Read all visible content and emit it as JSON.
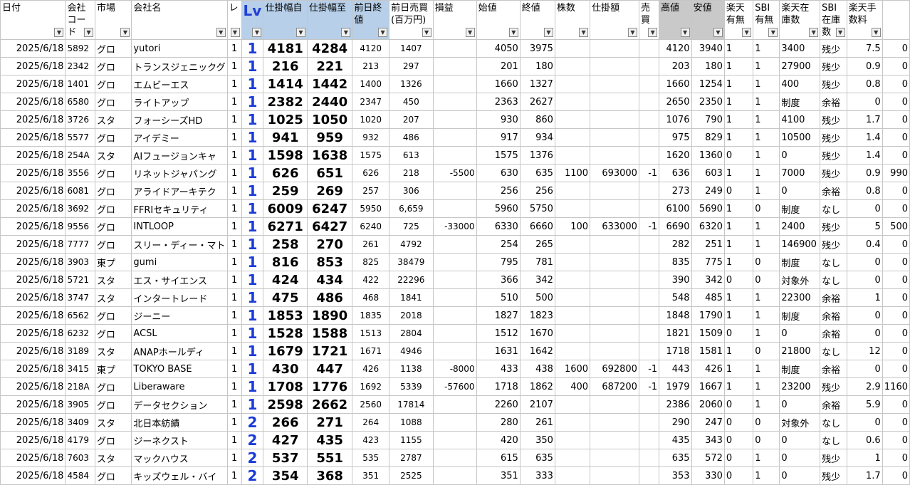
{
  "headers": [
    {
      "label": "日付"
    },
    {
      "label": "会社コード"
    },
    {
      "label": "市場"
    },
    {
      "label": "会社名"
    },
    {
      "label": "レ"
    },
    {
      "label": "Lv"
    },
    {
      "label": "仕掛幅自"
    },
    {
      "label": "仕掛幅至"
    },
    {
      "label": "前日終値"
    },
    {
      "label": "前日売買(百万円)"
    },
    {
      "label": "損益"
    },
    {
      "label": "始値"
    },
    {
      "label": "終値"
    },
    {
      "label": "株数"
    },
    {
      "label": "仕掛額"
    },
    {
      "label": "売買"
    },
    {
      "label": "高値"
    },
    {
      "label": "安値"
    },
    {
      "label": "楽天有無"
    },
    {
      "label": "SBI有無"
    },
    {
      "label": "楽天在庫数"
    },
    {
      "label": "SBI在庫数"
    },
    {
      "label": "楽天手数料"
    },
    {
      "label": ""
    }
  ],
  "rows": [
    [
      "2025/6/18",
      "5892",
      "グロ",
      "yutori",
      "1",
      "1",
      "4181",
      "4284",
      "4120",
      "1407",
      "",
      "4050",
      "3975",
      "",
      "",
      "",
      "4120",
      "3940",
      "1",
      "1",
      "3400",
      "残少",
      "7.5",
      "0"
    ],
    [
      "2025/6/18",
      "2342",
      "グロ",
      "トランスジェニックグ",
      "1",
      "1",
      "216",
      "221",
      "213",
      "297",
      "",
      "201",
      "180",
      "",
      "",
      "",
      "203",
      "180",
      "1",
      "1",
      "27900",
      "残少",
      "0.9",
      "0"
    ],
    [
      "2025/6/18",
      "1401",
      "グロ",
      "エムビーエス",
      "1",
      "1",
      "1414",
      "1442",
      "1400",
      "1326",
      "",
      "1660",
      "1327",
      "",
      "",
      "",
      "1660",
      "1254",
      "1",
      "1",
      "400",
      "残少",
      "0.8",
      "0"
    ],
    [
      "2025/6/18",
      "6580",
      "グロ",
      "ライトアップ",
      "1",
      "1",
      "2382",
      "2440",
      "2347",
      "450",
      "",
      "2363",
      "2627",
      "",
      "",
      "",
      "2650",
      "2350",
      "1",
      "1",
      "制度",
      "余裕",
      "0",
      "0"
    ],
    [
      "2025/6/18",
      "3726",
      "スタ",
      "フォーシーズHD",
      "1",
      "1",
      "1025",
      "1050",
      "1020",
      "207",
      "",
      "930",
      "860",
      "",
      "",
      "",
      "1076",
      "790",
      "1",
      "1",
      "4100",
      "残少",
      "1.7",
      "0"
    ],
    [
      "2025/6/18",
      "5577",
      "グロ",
      "アイデミー",
      "1",
      "1",
      "941",
      "959",
      "932",
      "486",
      "",
      "917",
      "934",
      "",
      "",
      "",
      "975",
      "829",
      "1",
      "1",
      "10500",
      "残少",
      "1.4",
      "0"
    ],
    [
      "2025/6/18",
      "254A",
      "スタ",
      "AIフュージョンキャ",
      "1",
      "1",
      "1598",
      "1638",
      "1575",
      "613",
      "",
      "1575",
      "1376",
      "",
      "",
      "",
      "1620",
      "1360",
      "0",
      "1",
      "0",
      "残少",
      "1.4",
      "0"
    ],
    [
      "2025/6/18",
      "3556",
      "グロ",
      "リネットジャパング",
      "1",
      "1",
      "626",
      "651",
      "626",
      "218",
      "-5500",
      "630",
      "635",
      "1100",
      "693000",
      "-1",
      "636",
      "603",
      "1",
      "1",
      "7000",
      "残少",
      "0.9",
      "990"
    ],
    [
      "2025/6/18",
      "6081",
      "グロ",
      "アライドアーキテク",
      "1",
      "1",
      "259",
      "269",
      "257",
      "306",
      "",
      "256",
      "256",
      "",
      "",
      "",
      "273",
      "249",
      "0",
      "1",
      "0",
      "余裕",
      "0.8",
      "0"
    ],
    [
      "2025/6/18",
      "3692",
      "グロ",
      "FFRIセキュリティ",
      "1",
      "1",
      "6009",
      "6247",
      "5950",
      "6,659",
      "",
      "5960",
      "5750",
      "",
      "",
      "",
      "6100",
      "5690",
      "1",
      "0",
      "制度",
      "なし",
      "0",
      "0"
    ],
    [
      "2025/6/18",
      "9556",
      "グロ",
      "INTLOOP",
      "1",
      "1",
      "6271",
      "6427",
      "6240",
      "725",
      "-33000",
      "6330",
      "6660",
      "100",
      "633000",
      "-1",
      "6690",
      "6320",
      "1",
      "1",
      "2400",
      "残少",
      "5",
      "500"
    ],
    [
      "2025/6/18",
      "7777",
      "グロ",
      "スリー・ディー・マト",
      "1",
      "1",
      "258",
      "270",
      "261",
      "4792",
      "",
      "254",
      "265",
      "",
      "",
      "",
      "282",
      "251",
      "1",
      "1",
      "146900",
      "残少",
      "0.4",
      "0"
    ],
    [
      "2025/6/18",
      "3903",
      "東プ",
      "gumi",
      "1",
      "1",
      "816",
      "853",
      "825",
      "38479",
      "",
      "795",
      "781",
      "",
      "",
      "",
      "835",
      "775",
      "1",
      "0",
      "制度",
      "なし",
      "0",
      "0"
    ],
    [
      "2025/6/18",
      "5721",
      "スタ",
      "エス・サイエンス",
      "1",
      "1",
      "424",
      "434",
      "422",
      "22296",
      "",
      "366",
      "342",
      "",
      "",
      "",
      "390",
      "342",
      "0",
      "0",
      "対象外",
      "なし",
      "0",
      "0"
    ],
    [
      "2025/6/18",
      "3747",
      "スタ",
      "インタートレード",
      "1",
      "1",
      "475",
      "486",
      "468",
      "1841",
      "",
      "510",
      "500",
      "",
      "",
      "",
      "548",
      "485",
      "1",
      "1",
      "22300",
      "余裕",
      "1",
      "0"
    ],
    [
      "2025/6/18",
      "6562",
      "グロ",
      "ジーニー",
      "1",
      "1",
      "1853",
      "1890",
      "1835",
      "2018",
      "",
      "1827",
      "1823",
      "",
      "",
      "",
      "1848",
      "1790",
      "1",
      "1",
      "制度",
      "余裕",
      "0",
      "0"
    ],
    [
      "2025/6/18",
      "6232",
      "グロ",
      "ACSL",
      "1",
      "1",
      "1528",
      "1588",
      "1513",
      "2804",
      "",
      "1512",
      "1670",
      "",
      "",
      "",
      "1821",
      "1509",
      "0",
      "1",
      "0",
      "余裕",
      "0",
      "0"
    ],
    [
      "2025/6/18",
      "3189",
      "スタ",
      "ANAPホールディ",
      "1",
      "1",
      "1679",
      "1721",
      "1671",
      "4946",
      "",
      "1631",
      "1642",
      "",
      "",
      "",
      "1718",
      "1581",
      "1",
      "0",
      "21800",
      "なし",
      "12",
      "0"
    ],
    [
      "2025/6/18",
      "3415",
      "東プ",
      "TOKYO BASE",
      "1",
      "1",
      "430",
      "447",
      "426",
      "1138",
      "-8000",
      "433",
      "438",
      "1600",
      "692800",
      "-1",
      "443",
      "426",
      "1",
      "1",
      "制度",
      "余裕",
      "0",
      "0"
    ],
    [
      "2025/6/18",
      "218A",
      "グロ",
      "Liberaware",
      "1",
      "1",
      "1708",
      "1776",
      "1692",
      "5339",
      "-57600",
      "1718",
      "1862",
      "400",
      "687200",
      "-1",
      "1979",
      "1667",
      "1",
      "1",
      "23200",
      "残少",
      "2.9",
      "1160"
    ],
    [
      "2025/6/18",
      "3905",
      "グロ",
      "データセクション",
      "1",
      "1",
      "2598",
      "2662",
      "2560",
      "17814",
      "",
      "2260",
      "2107",
      "",
      "",
      "",
      "2386",
      "2060",
      "0",
      "1",
      "0",
      "余裕",
      "5.9",
      "0"
    ],
    [
      "2025/6/18",
      "3409",
      "スタ",
      "北日本紡績",
      "1",
      "2",
      "266",
      "271",
      "264",
      "1088",
      "",
      "280",
      "261",
      "",
      "",
      "",
      "290",
      "247",
      "0",
      "0",
      "対象外",
      "なし",
      "0",
      "0"
    ],
    [
      "2025/6/18",
      "4179",
      "グロ",
      "ジーネクスト",
      "1",
      "2",
      "427",
      "435",
      "423",
      "1155",
      "",
      "420",
      "350",
      "",
      "",
      "",
      "435",
      "343",
      "0",
      "0",
      "0",
      "なし",
      "0.6",
      "0"
    ],
    [
      "2025/6/18",
      "7603",
      "スタ",
      "マックハウス",
      "1",
      "2",
      "537",
      "551",
      "535",
      "2787",
      "",
      "615",
      "635",
      "",
      "",
      "",
      "635",
      "572",
      "0",
      "1",
      "0",
      "残少",
      "1",
      "0"
    ],
    [
      "2025/6/18",
      "4584",
      "グロ",
      "キッズウェル・バイ",
      "1",
      "2",
      "354",
      "368",
      "351",
      "2525",
      "",
      "351",
      "333",
      "",
      "",
      "",
      "353",
      "330",
      "0",
      "1",
      "0",
      "残少",
      "1.7",
      "0"
    ]
  ]
}
